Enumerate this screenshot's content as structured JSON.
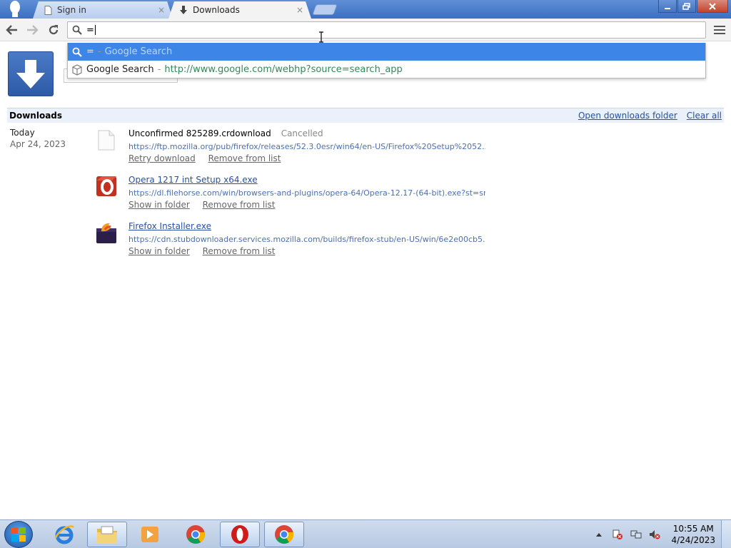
{
  "browser": {
    "tabs": [
      {
        "label": "Sign in",
        "active": false
      },
      {
        "label": "Downloads",
        "active": true
      }
    ],
    "omnibox": {
      "value": "="
    },
    "suggestions": [
      {
        "query": "=",
        "sep": "-",
        "provider": "Google Search",
        "selected": true
      },
      {
        "title": "Google Search",
        "sep": "-",
        "url": "http://www.google.com/webhp?source=search_app",
        "selected": false
      }
    ]
  },
  "downloads": {
    "header_title": "Downloads",
    "open_folder_label": "Open downloads folder",
    "clear_all_label": "Clear all",
    "date_group": {
      "today": "Today",
      "date": "Apr 24, 2023"
    },
    "items": [
      {
        "name": "Unconfirmed 825289.crdownload",
        "status": "Cancelled",
        "url": "https://ftp.mozilla.org/pub/firefox/releases/52.3.0esr/win64/en-US/Firefox%20Setup%2052.3....",
        "actions": [
          "Retry download",
          "Remove from list"
        ]
      },
      {
        "name": "Opera 1217 int Setup x64.exe",
        "status": "",
        "url": "https://dl.filehorse.com/win/browsers-and-plugins/opera-64/Opera-12.17-(64-bit).exe?st=sr...",
        "actions": [
          "Show in folder",
          "Remove from list"
        ]
      },
      {
        "name": "Firefox Installer.exe",
        "status": "",
        "url": "https://cdn.stubdownloader.services.mozilla.com/builds/firefox-stub/en-US/win/6e2e00cb5...",
        "actions": [
          "Show in folder",
          "Remove from list"
        ]
      }
    ]
  },
  "taskbar": {
    "apps": [
      "internet-explorer",
      "file-explorer",
      "media-player",
      "chrome",
      "opera",
      "chrome-active"
    ],
    "clock_time": "10:55 AM",
    "clock_date": "4/24/2023"
  },
  "colors": {
    "accent": "#3d86e8",
    "link": "#2650a8",
    "header_bg": "#ebf1fa"
  }
}
